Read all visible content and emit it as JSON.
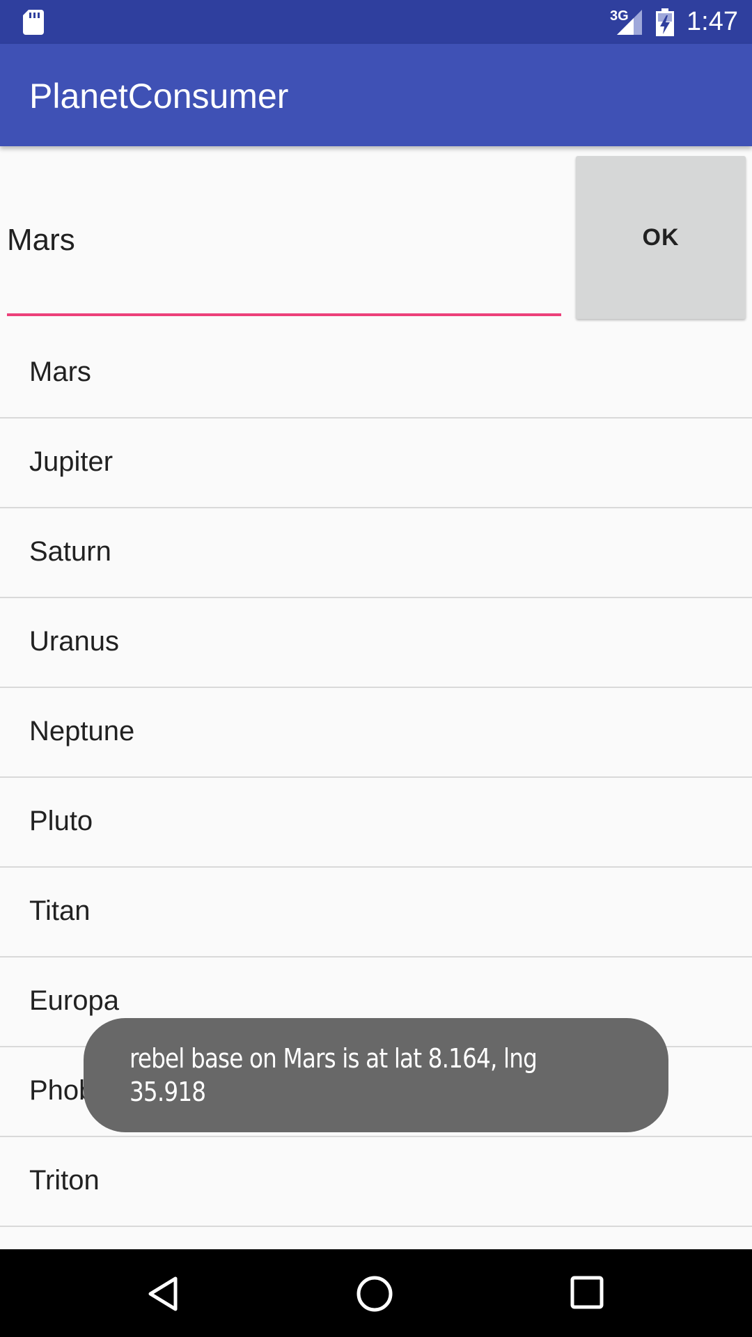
{
  "status_bar": {
    "network": "3G",
    "time": "1:47",
    "icons": [
      "sd-card-icon",
      "signal-icon",
      "battery-charging-icon"
    ]
  },
  "app_bar": {
    "title": "PlanetConsumer"
  },
  "input": {
    "value": "Mars",
    "underline_color": "#ec407a"
  },
  "ok_button": {
    "label": "OK"
  },
  "planets": [
    "Mars",
    "Jupiter",
    "Saturn",
    "Uranus",
    "Neptune",
    "Pluto",
    "Titan",
    "Europa",
    "Phobos",
    "Triton"
  ],
  "toast": {
    "message": "rebel base on Mars is at lat 8.164, lng 35.918"
  },
  "nav_bar": {
    "icons": [
      "back-icon",
      "home-icon",
      "recents-icon"
    ]
  },
  "colors": {
    "status_bar": "#2f3f9e",
    "app_bar": "#3f51b5",
    "accent": "#ec407a",
    "button": "#d6d7d7",
    "toast": "#686868"
  }
}
